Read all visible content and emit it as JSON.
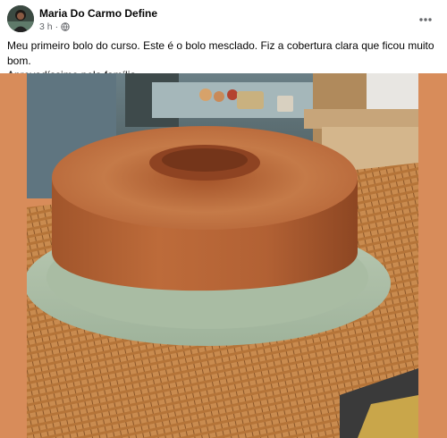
{
  "post": {
    "author": {
      "name": "Maria Do Carmo Define",
      "avatar_icon": "avatar-photo"
    },
    "timestamp": "3 h",
    "separator": "·",
    "audience_icon": "globe-icon",
    "more_icon": "more-options-icon",
    "caption": {
      "line1": "Meu primeiro bolo do curso. Este é o bolo mesclado. Fiz a cobertura clara que ficou muito bom.",
      "line2": "Aprovadíssimo pela família"
    },
    "photo": {
      "subject": "cake-on-plate",
      "background_color": "#d88c5a"
    }
  }
}
